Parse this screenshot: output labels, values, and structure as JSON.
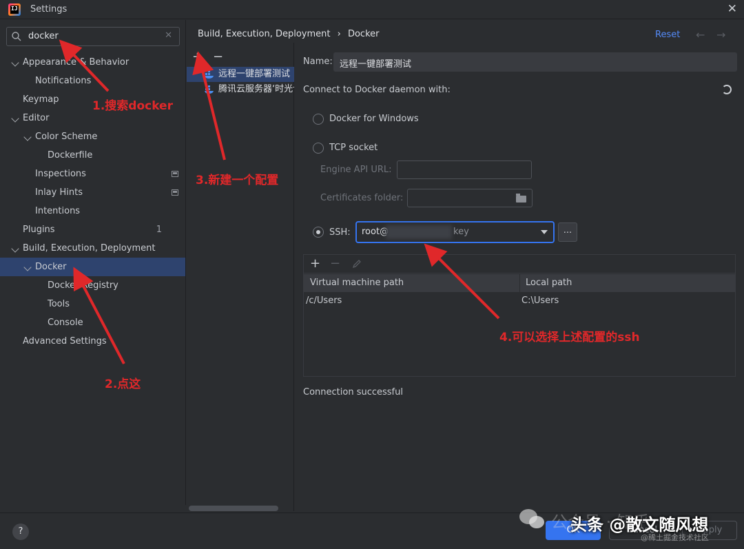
{
  "window": {
    "title": "Settings"
  },
  "search": {
    "value": "docker"
  },
  "sidebar": {
    "items": [
      {
        "label": "Appearance & Behavior"
      },
      {
        "label": "Notifications"
      },
      {
        "label": "Keymap"
      },
      {
        "label": "Editor"
      },
      {
        "label": "Color Scheme"
      },
      {
        "label": "Dockerfile"
      },
      {
        "label": "Inspections"
      },
      {
        "label": "Inlay Hints"
      },
      {
        "label": "Intentions"
      },
      {
        "label": "Plugins",
        "badge": "1"
      },
      {
        "label": "Build, Execution, Deployment"
      },
      {
        "label": "Docker"
      },
      {
        "label": "Docker Registry"
      },
      {
        "label": "Tools"
      },
      {
        "label": "Console"
      },
      {
        "label": "Advanced Settings"
      }
    ]
  },
  "breadcrumb": {
    "parent": "Build, Execution, Deployment",
    "separator": "›",
    "current": "Docker"
  },
  "header": {
    "reset_label": "Reset"
  },
  "config_list": {
    "add_label": "+",
    "remove_label": "−",
    "items": [
      {
        "label": "远程一键部署测试"
      },
      {
        "label": "腾讯云服务器‘时光记"
      }
    ]
  },
  "form": {
    "name_label": "Name:",
    "name_value": "远程一键部署测试",
    "connect_label": "Connect to Docker daemon with:",
    "docker_windows_label": "Docker for Windows",
    "tcp_label": "TCP socket",
    "engine_api_label": "Engine API URL:",
    "cert_folder_label": "Certificates folder:",
    "ssh_label": "SSH:",
    "ssh_value_prefix": "root@",
    "ssh_value_suffix": "key",
    "dots_label": "..."
  },
  "path_table": {
    "col1": "Virtual machine path",
    "col2": "Local path",
    "rows": [
      {
        "vm": "/c/Users",
        "local": "C:\\Users"
      }
    ]
  },
  "status": {
    "text": "Connection successful"
  },
  "footer": {
    "help_label": "?",
    "ok_label": "OK",
    "cancel_label": "Cancel",
    "apply_label": "Apply"
  },
  "annotations": {
    "step1": "1.搜索docker",
    "step2": "2.点这",
    "step3": "3.新建一个配置",
    "step4": "4.可以选择上述配置的ssh"
  },
  "watermark": {
    "main": "头条 @散文随风想",
    "faint": "公众号 · 知乎",
    "csdn": "@稀土掘金技术社区"
  },
  "colors": {
    "accent": "#3574f0",
    "annotation": "#e0282a",
    "selection": "#2e436e"
  }
}
